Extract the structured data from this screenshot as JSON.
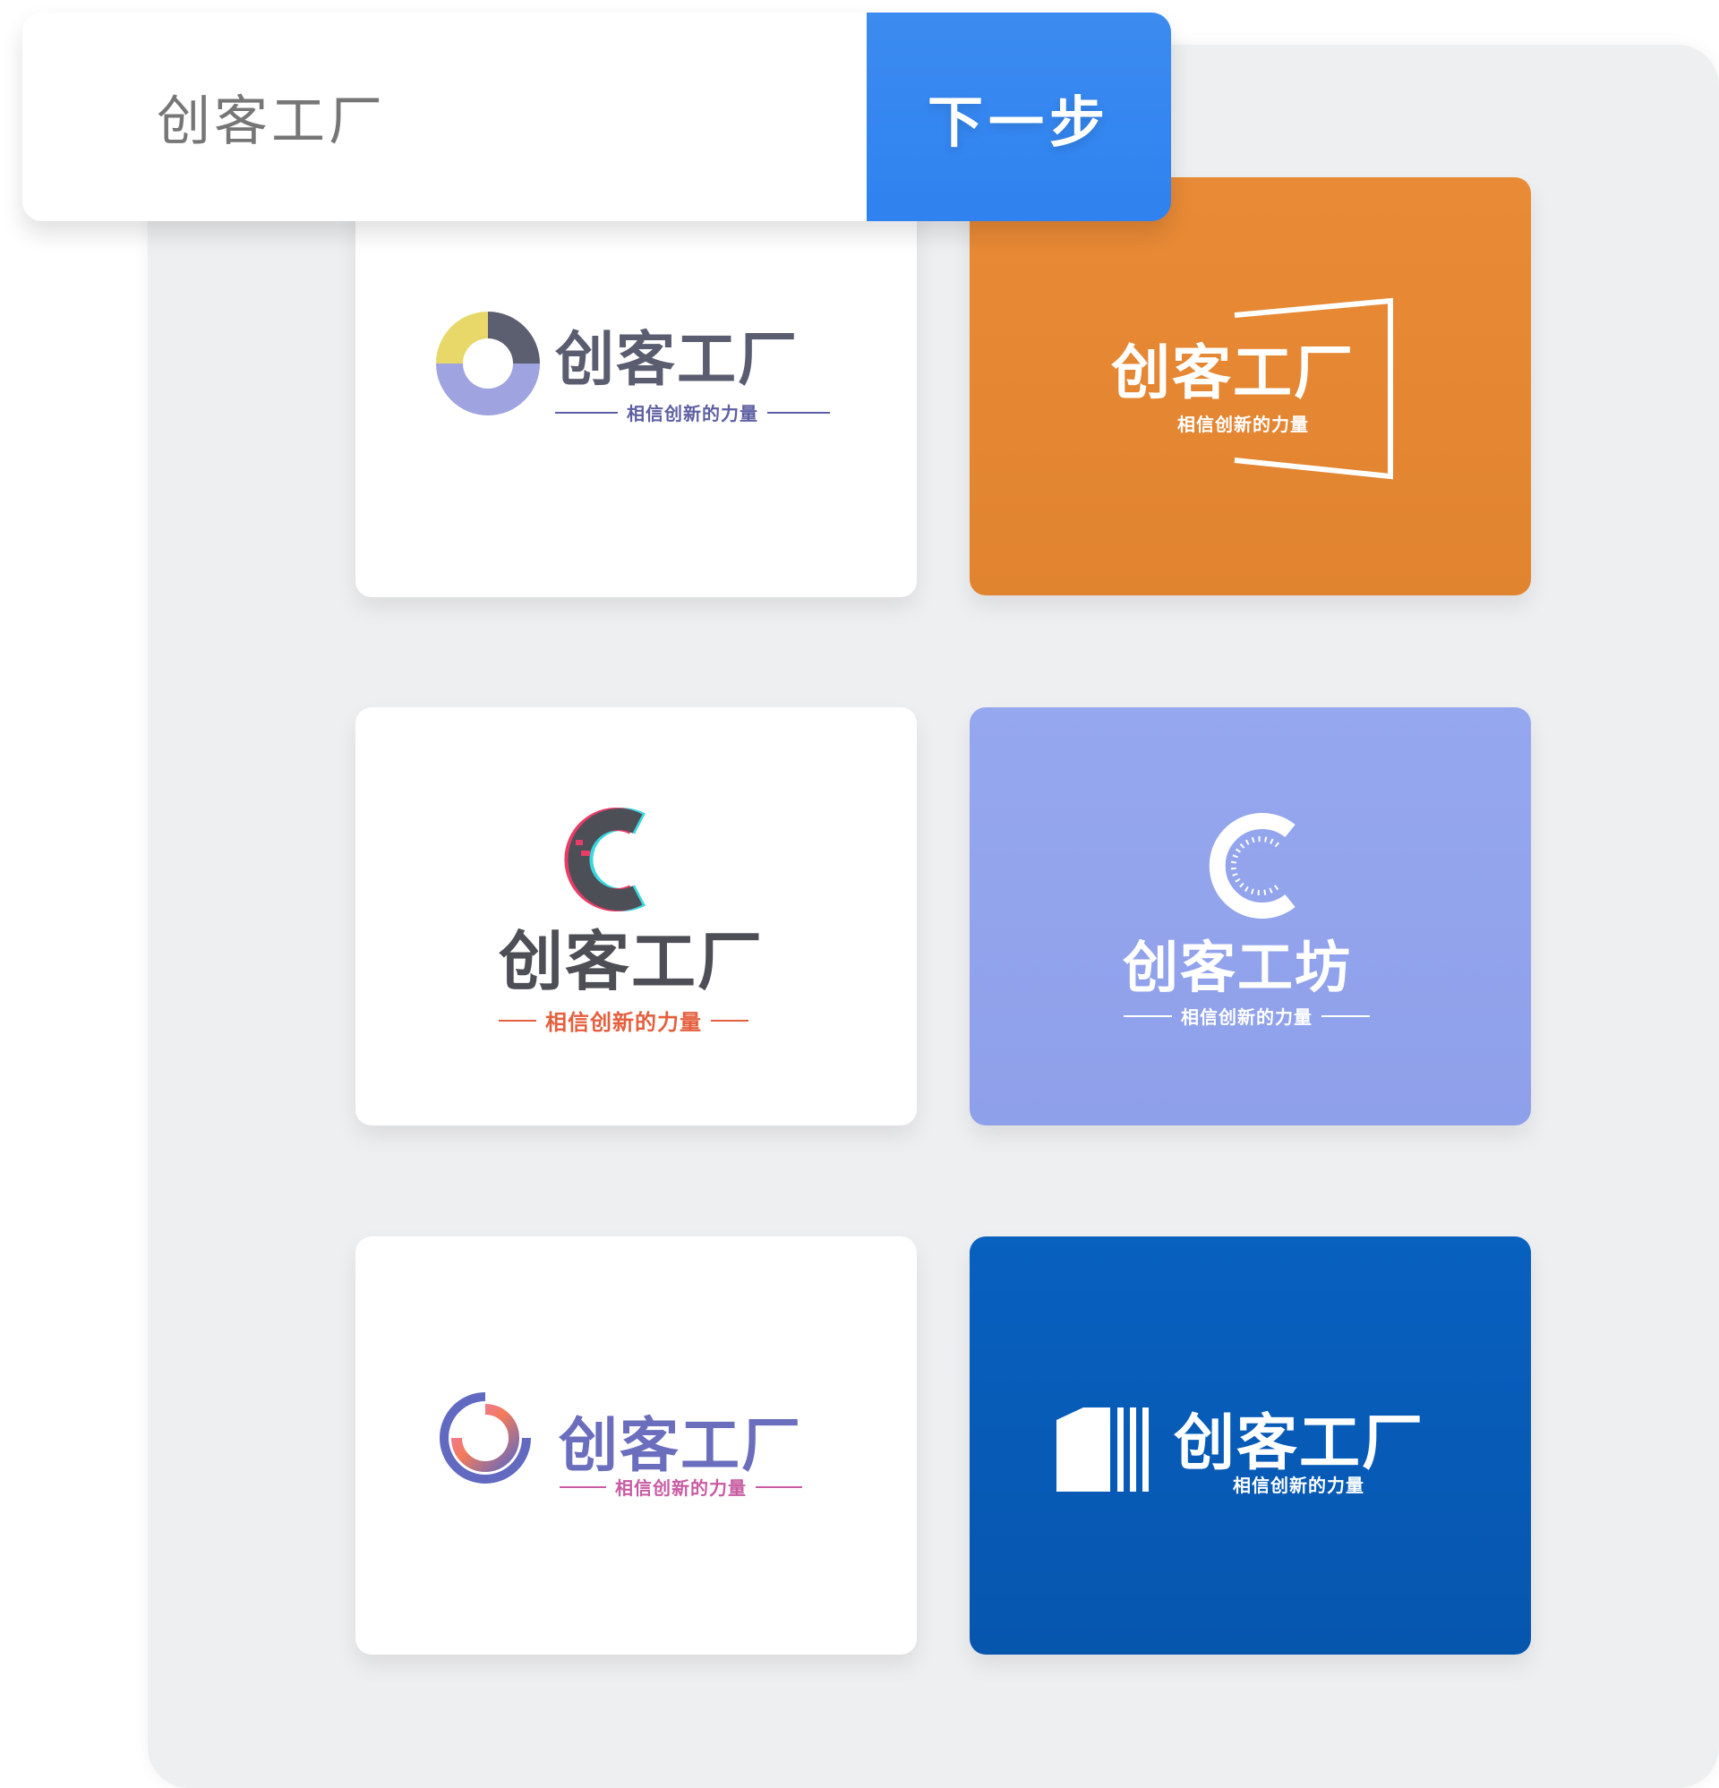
{
  "search": {
    "value": "创客工厂"
  },
  "actions": {
    "next_label": "下一步"
  },
  "theme": {
    "primary_button_color": "#2f82ef",
    "panel_background": "#eeeff1",
    "card_orange": "#e1842f",
    "card_periwinkle": "#8fa0ea",
    "card_blue": "#0656ae"
  },
  "logos": [
    {
      "title": "创客工厂",
      "tagline": "相信创新的力量",
      "title_color": "#5a5d6f",
      "tagline_color": "#5d5fa2",
      "mark_icon": "c-split-ring-icon"
    },
    {
      "title": "创客工厂",
      "tagline": "相信创新的力量",
      "title_color": "#ffffff",
      "tagline_color": "#ffffff",
      "mark_icon": "frame-outline-icon"
    },
    {
      "title": "创客工厂",
      "tagline": "相信创新的力量",
      "title_color": "#4e4f56",
      "tagline_color": "#e45f3e",
      "mark_icon": "glitch-c-icon"
    },
    {
      "title": "创客工坊",
      "tagline": "相信创新的力量",
      "title_color": "#ffffff",
      "tagline_color": "#ffffff",
      "mark_icon": "dotted-c-icon"
    },
    {
      "title": "创客工厂",
      "tagline": "相信创新的力量",
      "title_color": "#6a6ebd",
      "tagline_color": "#c85ba2",
      "mark_icon": "gradient-ring-icon"
    },
    {
      "title": "创客工厂",
      "tagline": "相信创新的力量",
      "title_color": "#ffffff",
      "tagline_color": "#ffffff",
      "mark_icon": "building-bars-icon"
    }
  ]
}
